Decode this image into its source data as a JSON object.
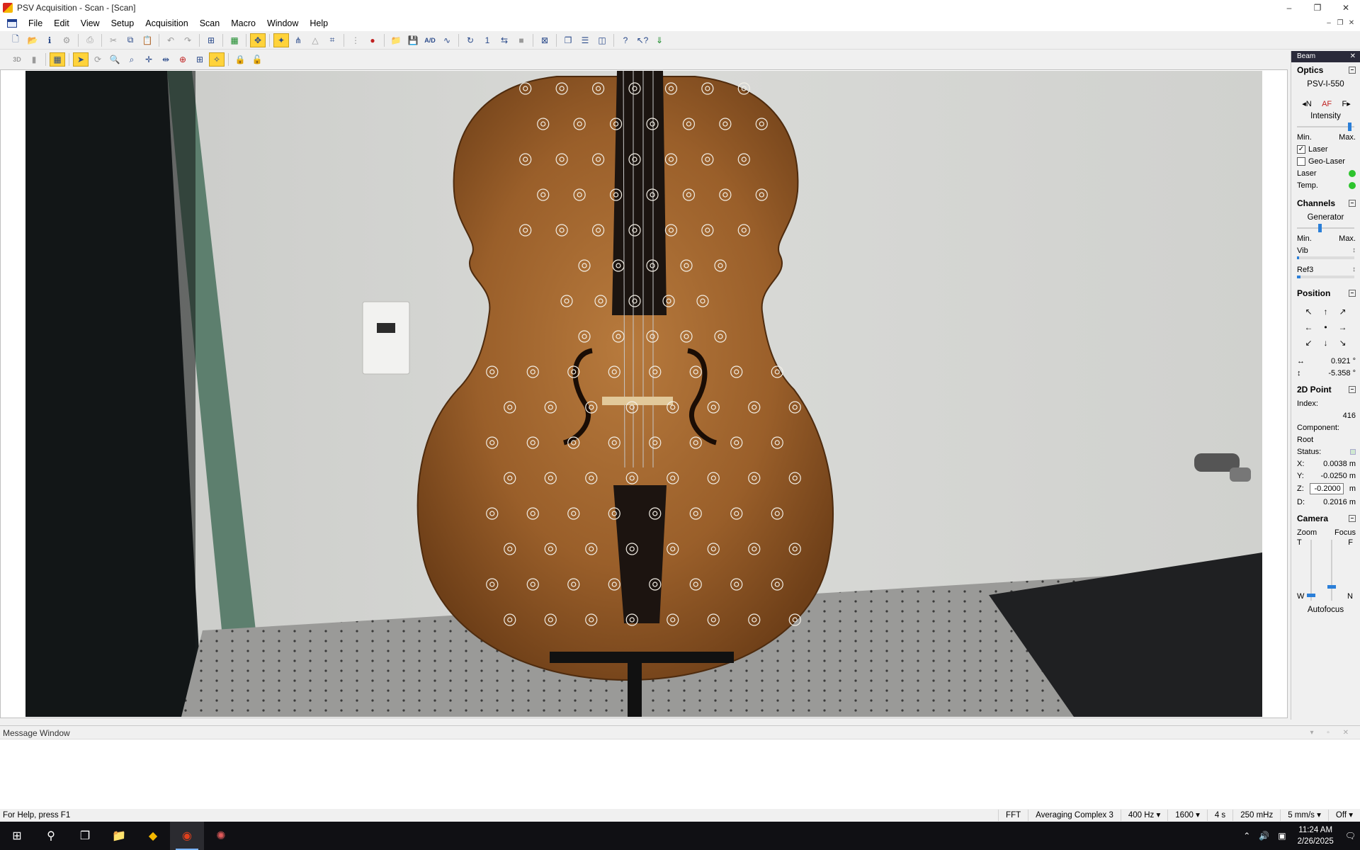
{
  "window": {
    "title": "PSV Acquisition - Scan - [Scan]",
    "controls": [
      "–",
      "❐",
      "✕"
    ],
    "mdi_controls": [
      "–",
      "❐",
      "✕"
    ]
  },
  "menu": [
    "File",
    "Edit",
    "View",
    "Setup",
    "Acquisition",
    "Scan",
    "Macro",
    "Window",
    "Help"
  ],
  "toolbar1": {
    "ad_label": "A/D",
    "one_label": "1"
  },
  "toolbar2": {
    "3d_label": "3D"
  },
  "right_panel": {
    "caption": "Beam",
    "optics": {
      "title": "Optics",
      "model": "PSV-I-550",
      "focus_n": "N",
      "focus_f": "F",
      "focus_auto": "AF",
      "intensity_label": "Intensity",
      "intensity_level": 0.95,
      "min": "Min.",
      "max": "Max.",
      "laser_checkbox": "Laser",
      "laser_checked": true,
      "geo_laser_checkbox": "Geo-Laser",
      "geo_laser_checked": false,
      "laser_status": "Laser",
      "temp_status": "Temp."
    },
    "channels": {
      "title": "Channels",
      "generator": "Generator",
      "generator_level": 0.4,
      "min": "Min.",
      "max": "Max.",
      "vib": "Vib",
      "ref3": "Ref3"
    },
    "position": {
      "title": "Position",
      "h_value": "0.921 °",
      "v_value": "-5.358 °"
    },
    "point2d": {
      "title": "2D Point",
      "index_label": "Index:",
      "index_value": "416",
      "component_label": "Component:",
      "component_value": "Root",
      "status_label": "Status:",
      "x_label": "X:",
      "x_value": "0.0038 m",
      "y_label": "Y:",
      "y_value": "-0.0250 m",
      "z_label": "Z:",
      "z_value": "-0.2000",
      "z_unit": "m",
      "d_label": "D:",
      "d_value": "0.2016 m"
    },
    "camera": {
      "title": "Camera",
      "zoom": "Zoom",
      "focus": "Focus",
      "t": "T",
      "f": "F",
      "w": "W",
      "n": "N",
      "zoom_level": 0.05,
      "focus_level": 0.2,
      "autofocus": "Autofocus"
    }
  },
  "message_window": {
    "caption": "Message Window"
  },
  "status_bar": {
    "help": "For Help, press F1",
    "fft": "FFT",
    "averaging": "Averaging Complex 3",
    "bandwidth": "400 Hz",
    "lines": "1600",
    "time": "4 s",
    "resolution": "250 mHz",
    "velocity": "5 mm/s",
    "off": "Off"
  },
  "taskbar": {
    "time": "11:24 AM",
    "date": "2/26/2025"
  }
}
